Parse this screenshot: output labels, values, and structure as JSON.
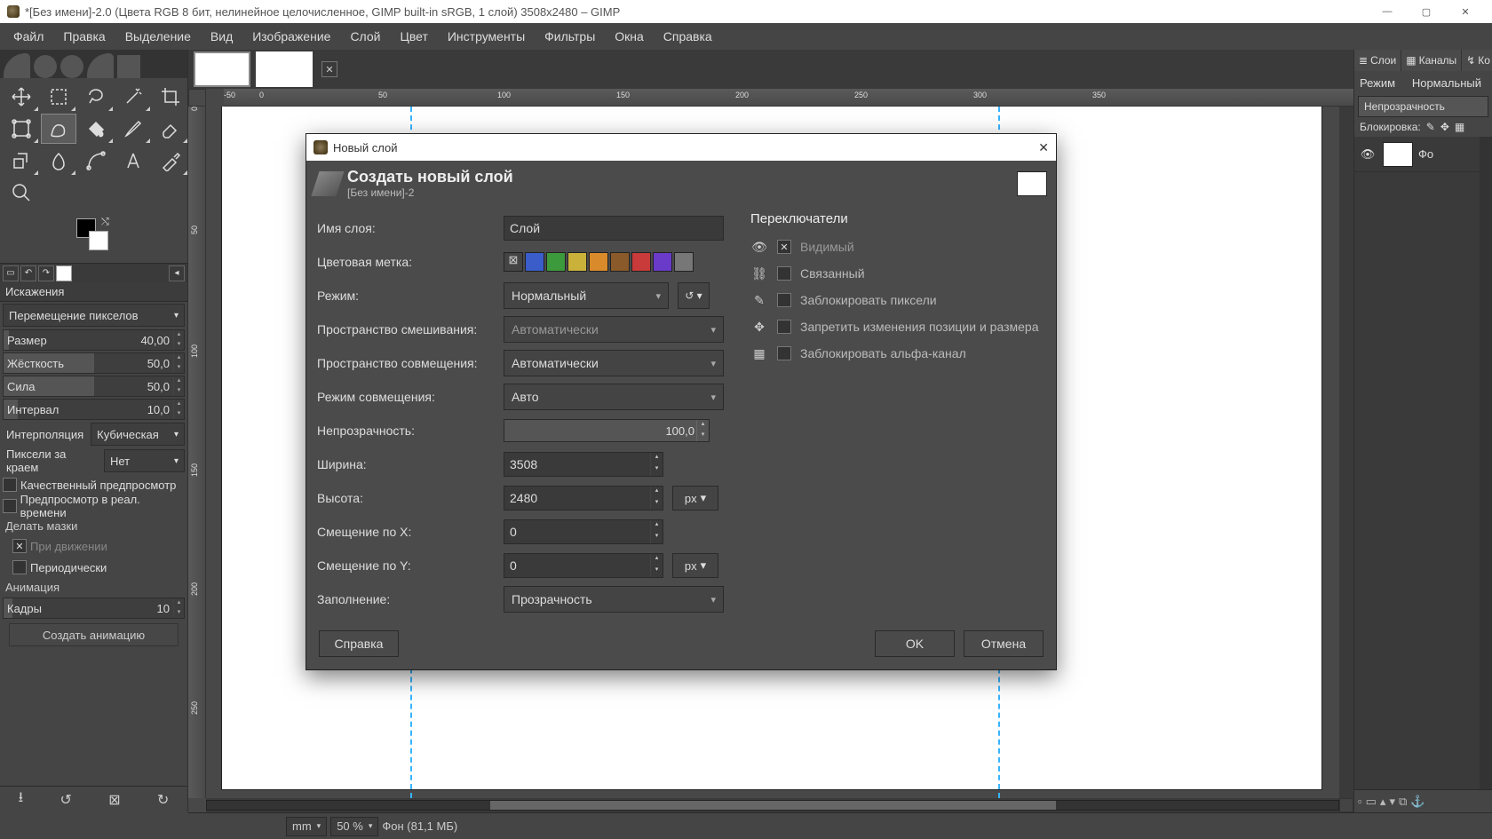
{
  "title": "*[Без имени]-2.0 (Цвета RGB 8 бит, нелинейное целочисленное, GIMP built-in sRGB, 1 слой) 3508x2480 – GIMP",
  "menu": [
    "Файл",
    "Правка",
    "Выделение",
    "Вид",
    "Изображение",
    "Слой",
    "Цвет",
    "Инструменты",
    "Фильтры",
    "Окна",
    "Справка"
  ],
  "toolopts": {
    "title": "Искажения",
    "move_mode": "Перемещение пикселов",
    "size_lbl": "Размер",
    "size": "40,00",
    "hardness_lbl": "Жёсткость",
    "hardness": "50,0",
    "force_lbl": "Сила",
    "force": "50,0",
    "interval_lbl": "Интервал",
    "interval": "10,0",
    "interp_lbl": "Интерполяция",
    "interp": "Кубическая",
    "edge_lbl": "Пиксели за краем",
    "edge": "Нет",
    "quality_preview": "Качественный предпросмотр",
    "realtime_preview": "Предпросмотр в реал. времени",
    "mask_hdr": "Делать мазки",
    "on_move": "При движении",
    "periodic": "Периодически",
    "anim_hdr": "Анимация",
    "frames_lbl": "Кадры",
    "frames": "10",
    "create_anim": "Создать анимацию"
  },
  "ruler_h": [
    0,
    50,
    100,
    150,
    200,
    250,
    300,
    350
  ],
  "ruler_h_neg": "-50",
  "ruler_v": [
    0,
    50,
    100,
    150,
    200,
    250
  ],
  "rightpanel": {
    "tabs": [
      "Слои",
      "Каналы",
      "Ко"
    ],
    "mode_lbl": "Режим",
    "mode": "Нормальный",
    "opacity_lbl": "Непрозрачность",
    "lock_lbl": "Блокировка:",
    "layer_name": "Фо"
  },
  "status": {
    "unit": "mm",
    "zoom": "50 %",
    "info": "Фон (81,1 МБ)"
  },
  "dialog": {
    "title": "Новый слой",
    "hdr": "Создать новый слой",
    "sub": "[Без имени]-2",
    "name_lbl": "Имя слоя:",
    "name": "Слой",
    "tag_lbl": "Цветовая метка:",
    "tag_colors": [
      "#555555",
      "#3a5dc9",
      "#3c9a3c",
      "#c9b13a",
      "#d98a2a",
      "#8a5a2a",
      "#c93a3a",
      "#6a3ac9",
      "#777777"
    ],
    "mode_lbl": "Режим:",
    "mode": "Нормальный",
    "blend_space_lbl": "Пространство смешивания:",
    "blend_space": "Автоматически",
    "comp_space_lbl": "Пространство совмещения:",
    "comp_space": "Автоматически",
    "comp_mode_lbl": "Режим совмещения:",
    "comp_mode": "Авто",
    "opacity_lbl": "Непрозрачность:",
    "opacity": "100,0",
    "width_lbl": "Ширина:",
    "width": "3508",
    "height_lbl": "Высота:",
    "height": "2480",
    "offx_lbl": "Смещение по X:",
    "offx": "0",
    "offy_lbl": "Смещение по Y:",
    "offy": "0",
    "fill_lbl": "Заполнение:",
    "fill": "Прозрачность",
    "unit": "px",
    "switches_hdr": "Переключатели",
    "sw_visible": "Видимый",
    "sw_linked": "Связанный",
    "sw_lockpx": "Заблокировать пиксели",
    "sw_lockpos": "Запретить изменения позиции и размера",
    "sw_lockalpha": "Заблокировать альфа-канал",
    "btn_help": "Справка",
    "btn_ok": "OK",
    "btn_cancel": "Отмена"
  }
}
